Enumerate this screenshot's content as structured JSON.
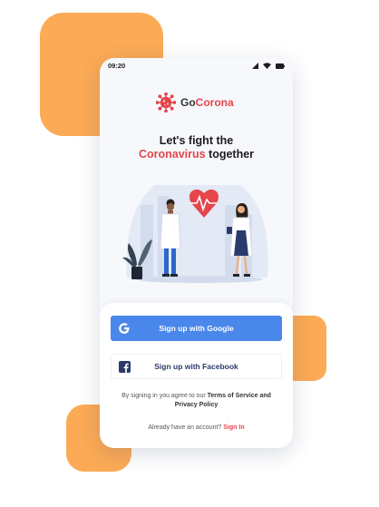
{
  "status": {
    "time": "09:20"
  },
  "brand": {
    "name_prefix": "Go",
    "name_accent": "Corona"
  },
  "headline": {
    "line1": "Let's fight the",
    "accent": "Coronavirus",
    "line2_rest": " together"
  },
  "buttons": {
    "google": "Sign up with Google",
    "facebook": "Sign up with Facebook"
  },
  "terms": {
    "prefix": "By signing in you agree to our ",
    "link1": "Terms of Service",
    "joiner": " and ",
    "link2": "Privacy Policy"
  },
  "signin": {
    "prompt": "Already have an account? ",
    "link": "Sign In"
  },
  "icons": {
    "logo": "coronavirus-icon",
    "google": "google-icon",
    "facebook": "facebook-icon",
    "signal": "signal-icon",
    "wifi": "wifi-icon",
    "battery": "battery-icon"
  },
  "colors": {
    "accent": "#e5454b",
    "google_button": "#4a87ea",
    "facebook_text": "#2a3a6c",
    "decor_orange": "#fcaa55"
  }
}
